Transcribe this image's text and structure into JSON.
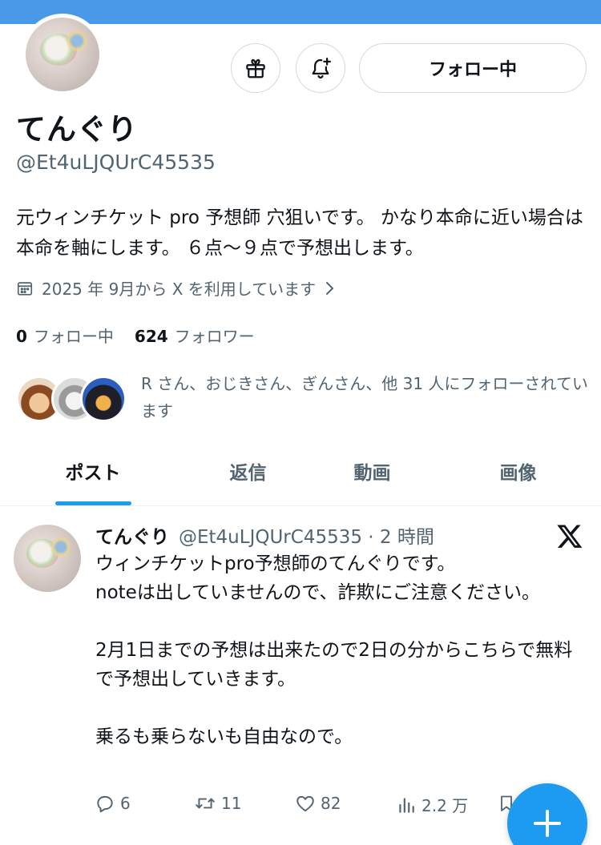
{
  "profile": {
    "name": "てんぐり",
    "handle": "@Et4uLJQUrC45535",
    "bio": "元ウィンチケット pro 予想師 穴狙いです。 かなり本命に近い場合は本命を軸にします。 ６点〜９点で予想出します。",
    "joined": "2025 年 9月から X を利用しています",
    "following_count": "0",
    "following_label": "フォロー中",
    "followers_count": "624",
    "followers_label": "フォロワー",
    "followed_by": "R さん、おじきさん、ぎんさん、他 31 人にフォローされています",
    "follow_button_label": "フォロー中"
  },
  "icons": {
    "gift": "gift-icon",
    "notify": "bell-plus-icon",
    "calendar": "calendar-icon",
    "chevron": "chevron-right-icon",
    "x_logo": "x-logo-icon",
    "compose": "plus-icon"
  },
  "tabs": [
    {
      "label": "ポスト",
      "active": true
    },
    {
      "label": "返信",
      "active": false
    },
    {
      "label": "動画",
      "active": false
    },
    {
      "label": "画像",
      "active": false
    }
  ],
  "post": {
    "name": "てんぐり",
    "meta": "@Et4uLJQUrC45535 · 2 時間",
    "lines": [
      "ウィンチケットpro予想師のてんぐりです。",
      "noteは出していませんので、詐欺にご注意ください。",
      "",
      "2月1日までの予想は出来たので2日の分からこちらで無料で予想出していきます。",
      "",
      "乗るも乗らないも自由なので。"
    ],
    "replies": "6",
    "reposts": "11",
    "likes": "82",
    "views": "2.2 万"
  },
  "colors": {
    "banner": "#4a99e9",
    "accent": "#1d9bf0",
    "text": "#0f1419",
    "muted": "#536471",
    "border": "#cfd9de"
  }
}
